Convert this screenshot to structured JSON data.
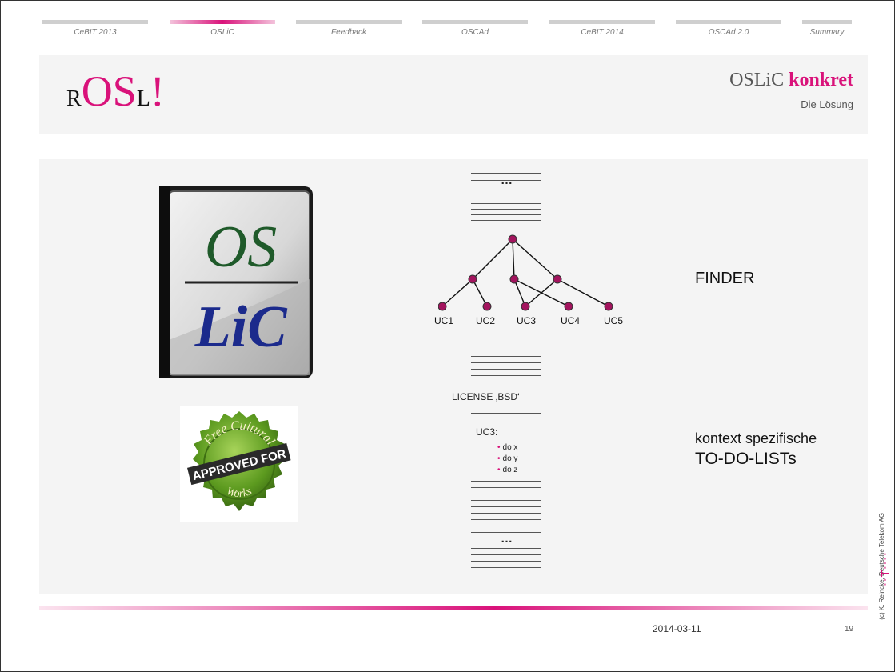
{
  "nav": [
    {
      "label": "CeBIT 2013",
      "active": false
    },
    {
      "label": "OSLiC",
      "active": true
    },
    {
      "label": "Feedback",
      "active": false
    },
    {
      "label": "OSCAd",
      "active": false
    },
    {
      "label": "CeBIT 2014",
      "active": false
    },
    {
      "label": "OSCAd 2.0",
      "active": false
    },
    {
      "label": "Summary",
      "active": false
    }
  ],
  "header": {
    "logo": {
      "r": "R",
      "os": "OS",
      "l": "L",
      "bang": "!"
    },
    "title_prefix": "OSLiC",
    "title_highlight": "konkret",
    "subtitle": "Die Lösung"
  },
  "book": {
    "top": "OS",
    "bottom": "LiC"
  },
  "badge": {
    "top": "Free Cultural",
    "middle": "APPROVED FOR",
    "bottom": "Works"
  },
  "diagram": {
    "top_ellipsis": "…",
    "bottom_ellipsis": "…",
    "leaves": [
      "UC1",
      "UC2",
      "UC3",
      "UC4",
      "UC5"
    ],
    "license_text": "LICENSE ‚BSD‘",
    "uc3_title": "UC3:",
    "uc3_items": [
      "do x",
      "do y",
      "do z"
    ]
  },
  "labels": {
    "finder": "FINDER",
    "todo_line1": "kontext spezifische",
    "todo_line2": "TO-DO-LISTs"
  },
  "footer": {
    "date": "2014-03-11",
    "page": "19",
    "copyright": "(c) K. Reincke, Deutsche Telekom AG",
    "telekom_logo": "··T····"
  },
  "colors": {
    "accent": "#d9127a",
    "book_green": "#1f5a2a",
    "book_blue": "#1b2a8c",
    "badge_green": "#5c9a1f"
  }
}
